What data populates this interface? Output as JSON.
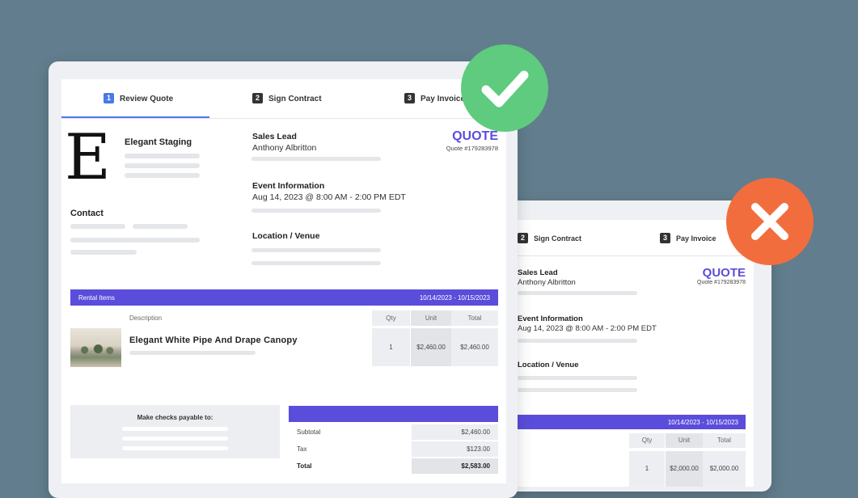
{
  "colors": {
    "background": "#627d8d",
    "accent": "#5b4ddb",
    "active_step": "#4a78e8",
    "approve": "#5ecb7e",
    "reject": "#f26d3d"
  },
  "left": {
    "steps": [
      {
        "num": "1",
        "label": "Review Quote"
      },
      {
        "num": "2",
        "label": "Sign Contract"
      },
      {
        "num": "3",
        "label": "Pay Invoice"
      }
    ],
    "logo_letter": "E",
    "company_name": "Elegant Staging",
    "contact_label": "Contact",
    "sales_lead_label": "Sales Lead",
    "sales_lead_name": "Anthony Albritton",
    "event_label": "Event Information",
    "event_date": "Aug 14, 2023 @ 8:00 AM - 2:00 PM EDT",
    "location_label": "Location / Venue",
    "quote_title": "QUOTE",
    "quote_number": "Quote #179283978",
    "rental_label": "Rental Items",
    "rental_dates": "10/14/2023 - 10/15/2023",
    "col_description": "Description",
    "col_qty": "Qty",
    "col_unit": "Unit",
    "col_total": "Total",
    "item_name": "Elegant White Pipe And Drape Canopy",
    "item_qty": "1",
    "item_unit": "$2,460.00",
    "item_total": "$2,460.00",
    "checks_label": "Make checks payable to:",
    "subtotal_label": "Subtotal",
    "subtotal": "$2,460.00",
    "tax_label": "Tax",
    "tax": "$123.00",
    "total_label": "Total",
    "total": "$2,583.00"
  },
  "right": {
    "steps": [
      {
        "num": "2",
        "label": "Sign Contract"
      },
      {
        "num": "3",
        "label": "Pay Invoice"
      }
    ],
    "sales_lead_label": "Sales Lead",
    "sales_lead_name": "Anthony Albritton",
    "event_label": "Event Information",
    "event_date": "Aug 14, 2023 @ 8:00 AM - 2:00 PM EDT",
    "location_label": "Location / Venue",
    "quote_title": "QUOTE",
    "quote_number": "Quote #179283978",
    "rental_dates": "10/14/2023 - 10/15/2023",
    "col_qty": "Qty",
    "col_unit": "Unit",
    "col_total": "Total",
    "item_qty": "1",
    "item_unit": "$2,000.00",
    "item_total": "$2,000.00"
  },
  "icons": {
    "approve": "checkmark-icon",
    "reject": "x-icon"
  }
}
